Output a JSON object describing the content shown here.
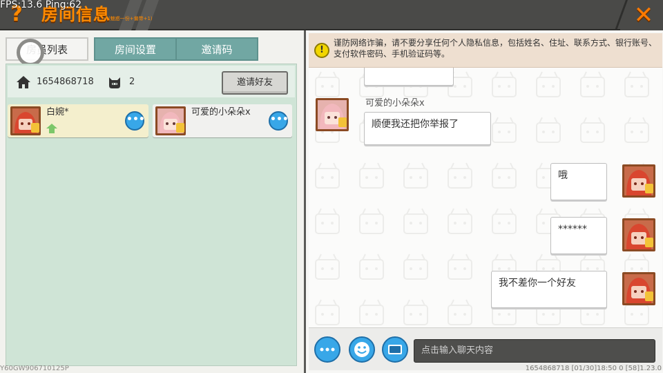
{
  "debug": {
    "fps_text": "FPS:13.6  Ping:62"
  },
  "header": {
    "help_icon": "question-mark",
    "title": "房间信息",
    "subtitle": "(魅惑一份+偏带+1)",
    "close_icon": "close-x"
  },
  "tabs": [
    {
      "label": "房员列表",
      "active": true
    },
    {
      "label": "房间设置",
      "active": false
    },
    {
      "label": "邀请码",
      "active": false
    }
  ],
  "room": {
    "id": "1654868718",
    "member_count": "2",
    "invite_label": "邀请好友"
  },
  "members": [
    {
      "name": "白婉*",
      "is_host": true,
      "highlighted": true
    },
    {
      "name": "可爱的小朵朵x",
      "is_host": false,
      "highlighted": false
    }
  ],
  "warning": {
    "text": "谨防网络诈骗，请不要分享任何个人隐私信息，包括姓名、住址、联系方式、银行账号、支付软件密码、手机验证码等。"
  },
  "chat": {
    "messages": [
      {
        "side": "left",
        "sender": "可爱的小朵朵x",
        "text": "顺便我还把你举报了"
      },
      {
        "side": "right",
        "text": "哦"
      },
      {
        "side": "right",
        "text": "******"
      },
      {
        "side": "right",
        "text": "我不差你一个好友"
      }
    ],
    "input_placeholder": "点击输入聊天内容"
  },
  "footer": {
    "version": "Y60GW906710125P",
    "status": "1654868718   [01/30]18:50 0   [58]1.23.0"
  },
  "colors": {
    "accent": "#ff8a00",
    "tab_bg": "#71a7a3",
    "members_bg": "#cfe4d6",
    "button_blue": "#38a7e8",
    "warning_bg": "#eedfd0"
  }
}
